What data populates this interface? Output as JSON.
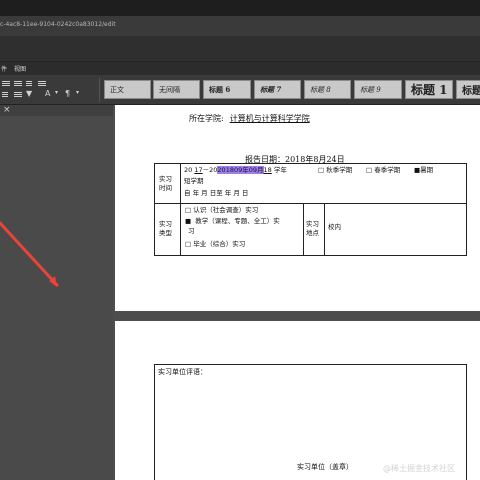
{
  "browser": {
    "url_fragment": "c-4ac8-11ee-9104-0242c0a83012/edit"
  },
  "menu": {
    "item_left": "件",
    "item_view": "视图"
  },
  "toolbar": {
    "font_color_glyph": "A",
    "icon_names": [
      "align-left-icon",
      "align-center-icon",
      "align-right-icon",
      "justify-icon",
      "list-icon",
      "indent-icon",
      "text-color-icon",
      "highlight-icon"
    ]
  },
  "styles": {
    "zhengwen": "正文",
    "wujiange": "无间隔",
    "heading6": "标题 6",
    "heading7": "标题 7",
    "heading8": "标题 8",
    "heading9": "标题 9",
    "heading1": "标题 1",
    "heading2": "标题"
  },
  "doc": {
    "college_label": "所在学院:",
    "college_value": "计算机与计算科学学院",
    "report_date": "报告日期：2018年8月24日",
    "table": {
      "time_label_1": "实习",
      "time_label_2": "时间",
      "year_prefix": "20",
      "year_from": "17",
      "year_dash": "－20",
      "year_highlight": "201809年09月",
      "year_to": "18",
      "year_suffix": "学年",
      "autumn": "□ 秋季学期",
      "spring": "□ 春季学期",
      "summer": "■暑期",
      "short_term": "短学期",
      "from_to_row": "自    年    月    日至         年    月    日",
      "type_label_1": "实习",
      "type_label_2": "类型",
      "type_opt1": "□ 认识（社会调查）实习",
      "type_opt2_mark": "■",
      "type_opt2": "教学（课程、专题、全工）实",
      "type_opt2b": "习",
      "type_opt3": "□ 毕业（综合）实习",
      "place_label_1": "实习",
      "place_label_2": "地点",
      "place_value": "校内"
    },
    "eval_label": "实习单位评语：",
    "eval_sign": "实习单位（盖章）"
  },
  "colors": {
    "highlight": "#9d7fe6",
    "annotation_arrow": "#e8443a",
    "toolbar_bg": "#3a3a3a",
    "style_box_bg": "#c9c9c9"
  },
  "watermark": "@稀土掘金技术社区"
}
